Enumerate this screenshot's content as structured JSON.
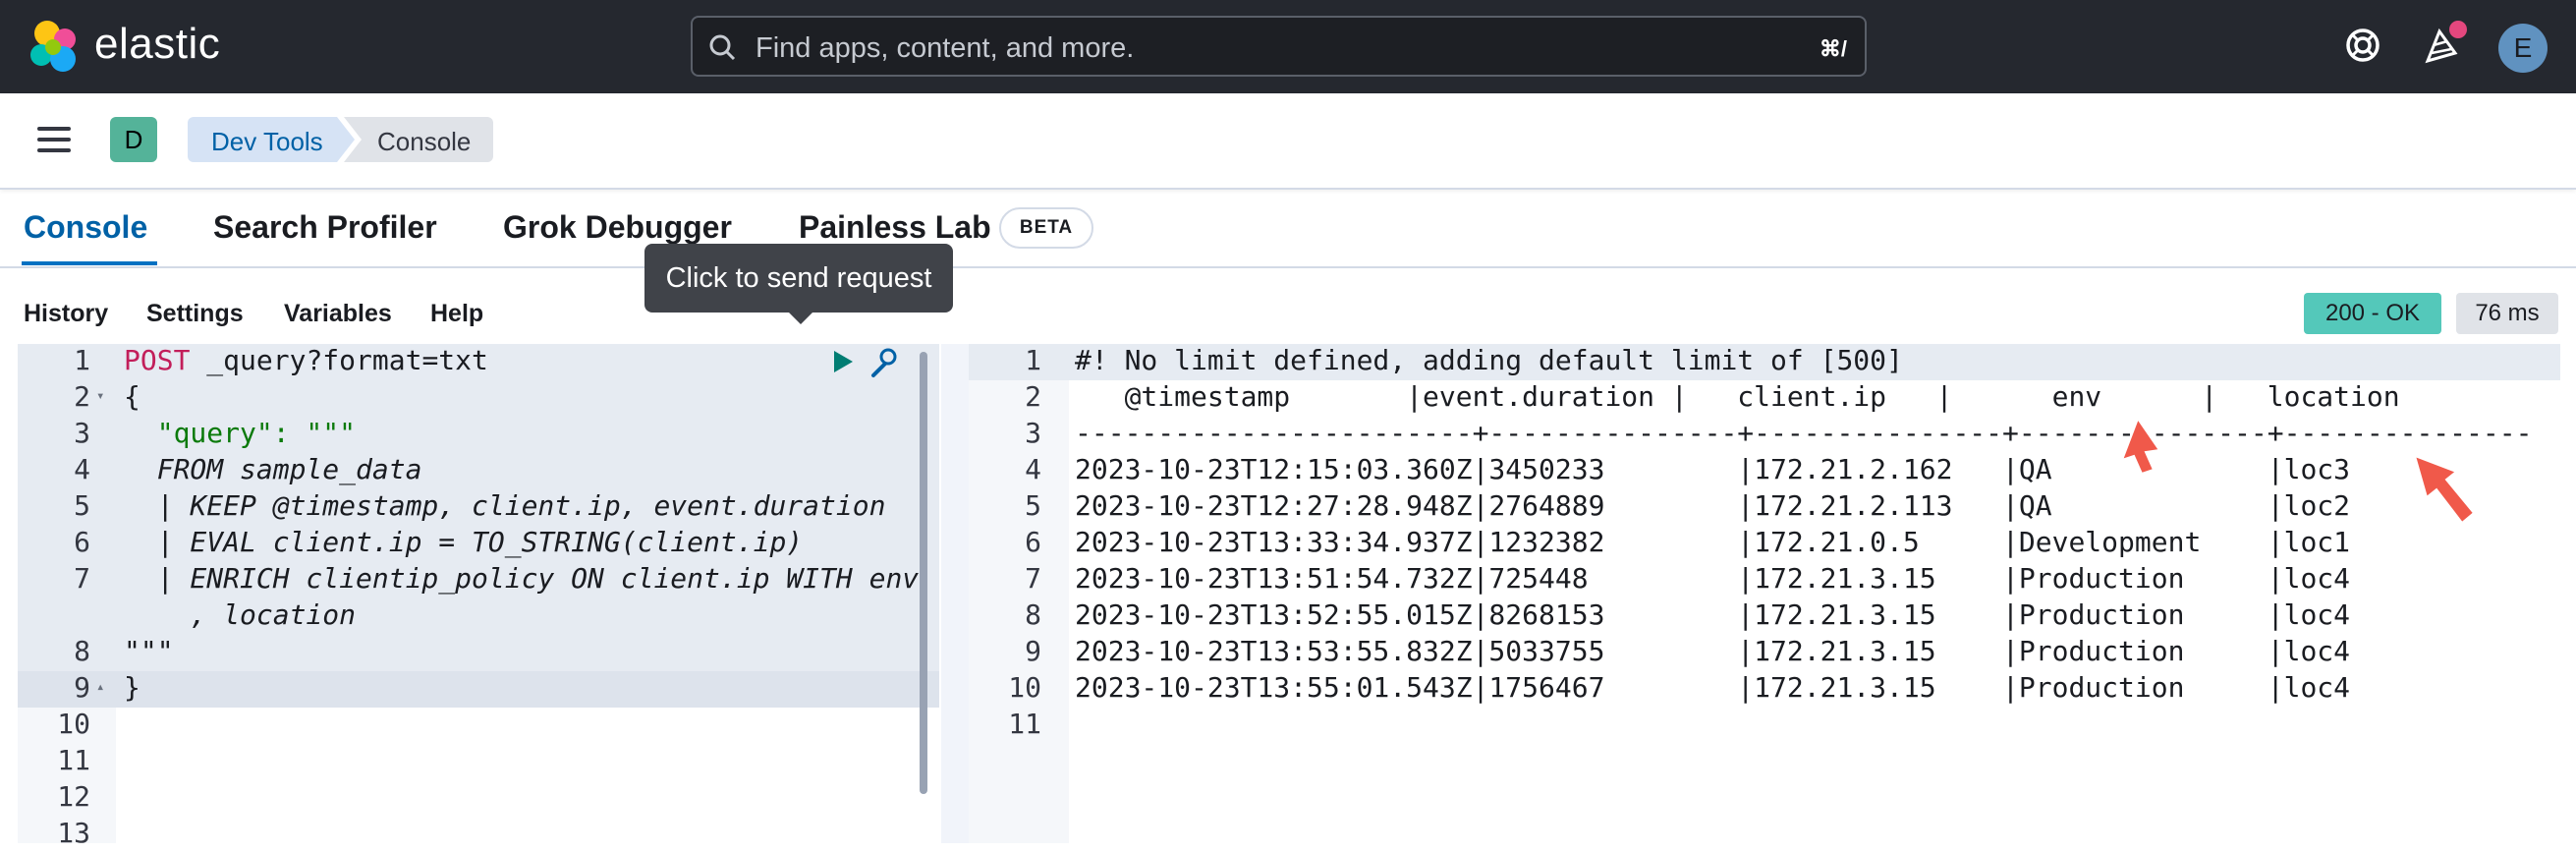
{
  "header": {
    "logo_text": "elastic",
    "search_placeholder": "Find apps, content, and more.",
    "search_shortcut": "⌘/",
    "avatar_initial": "E"
  },
  "subheader": {
    "space_initial": "D",
    "breadcrumbs": [
      "Dev Tools",
      "Console"
    ]
  },
  "tabs": [
    {
      "label": "Console",
      "active": true
    },
    {
      "label": "Search Profiler"
    },
    {
      "label": "Grok Debugger"
    },
    {
      "label": "Painless Lab",
      "badge": "BETA"
    }
  ],
  "menu": [
    "History",
    "Settings",
    "Variables",
    "Help"
  ],
  "tooltip": "Click to send request",
  "response": {
    "status": "200 - OK",
    "time": "76 ms"
  },
  "editor": {
    "line_numbers": [
      "1",
      "2",
      "3",
      "4",
      "5",
      "6",
      "7",
      "",
      "8",
      "9",
      "10",
      "11",
      "12",
      "13"
    ],
    "lines": [
      {
        "method": "POST",
        "rest": " _query?format=txt"
      },
      {
        "text": "{"
      },
      {
        "key": "  \"query\"",
        "rest": ": \"\"\""
      },
      {
        "query": "  FROM sample_data"
      },
      {
        "query": "  | KEEP @timestamp, client.ip, event.duration"
      },
      {
        "query": "  | EVAL client.ip = TO_STRING(client.ip)"
      },
      {
        "query": "  | ENRICH clientip_policy ON client.ip WITH env"
      },
      {
        "query": "    , location"
      },
      {
        "text": "\"\"\""
      },
      {
        "text": "}"
      }
    ]
  },
  "output": {
    "line_numbers": [
      "1",
      "2",
      "3",
      "4",
      "5",
      "6",
      "7",
      "8",
      "9",
      "10",
      "11"
    ],
    "lines": [
      "#! No limit defined, adding default limit of [500]",
      "   @timestamp       |event.duration |   client.ip   |      env      |   location   ",
      "------------------------+---------------+---------------+---------------+---------------",
      "2023-10-23T12:15:03.360Z|3450233        |172.21.2.162   |QA             |loc3",
      "2023-10-23T12:27:28.948Z|2764889        |172.21.2.113   |QA             |loc2",
      "2023-10-23T13:33:34.937Z|1232382        |172.21.0.5     |Development    |loc1",
      "2023-10-23T13:51:54.732Z|725448         |172.21.3.15    |Production     |loc4",
      "2023-10-23T13:52:55.015Z|8268153        |172.21.3.15    |Production     |loc4",
      "2023-10-23T13:53:55.832Z|5033755        |172.21.3.15    |Production     |loc4",
      "2023-10-23T13:55:01.543Z|1756467        |172.21.3.15    |Production     |loc4",
      ""
    ]
  },
  "colors": {
    "accent": "#0071c2",
    "status_ok": "#54c8ba",
    "annotation_arrow": "#f0594a"
  }
}
